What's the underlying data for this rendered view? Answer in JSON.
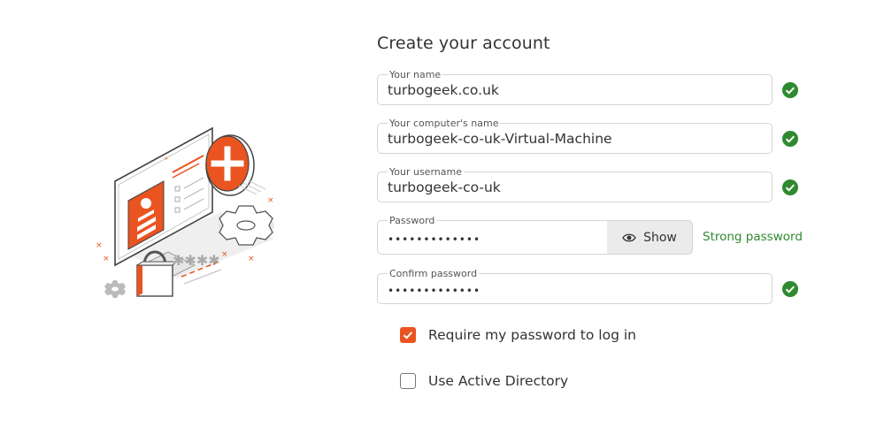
{
  "form": {
    "title": "Create your account",
    "fields": [
      {
        "label": "Your name",
        "value": "turbogeek.co.uk",
        "valid": true
      },
      {
        "label": "Your computer's name",
        "value": "turbogeek-co-uk-Virtual-Machine",
        "valid": true
      },
      {
        "label": "Your username",
        "value": "turbogeek-co-uk",
        "valid": true
      },
      {
        "label": "Password",
        "value": "•••••••••••••",
        "show_label": "Show",
        "strength": "Strong password"
      },
      {
        "label": "Confirm password",
        "value": "•••••••••••••",
        "valid": true
      }
    ],
    "options": [
      {
        "label": "Require my password to log in",
        "checked": true
      },
      {
        "label": "Use Active Directory",
        "checked": false
      }
    ]
  },
  "colors": {
    "accent": "#e95420",
    "success": "#2f8a2f",
    "border": "#d4d4d4"
  },
  "icons": {
    "valid": "check-circle-icon",
    "show": "eye-icon"
  }
}
